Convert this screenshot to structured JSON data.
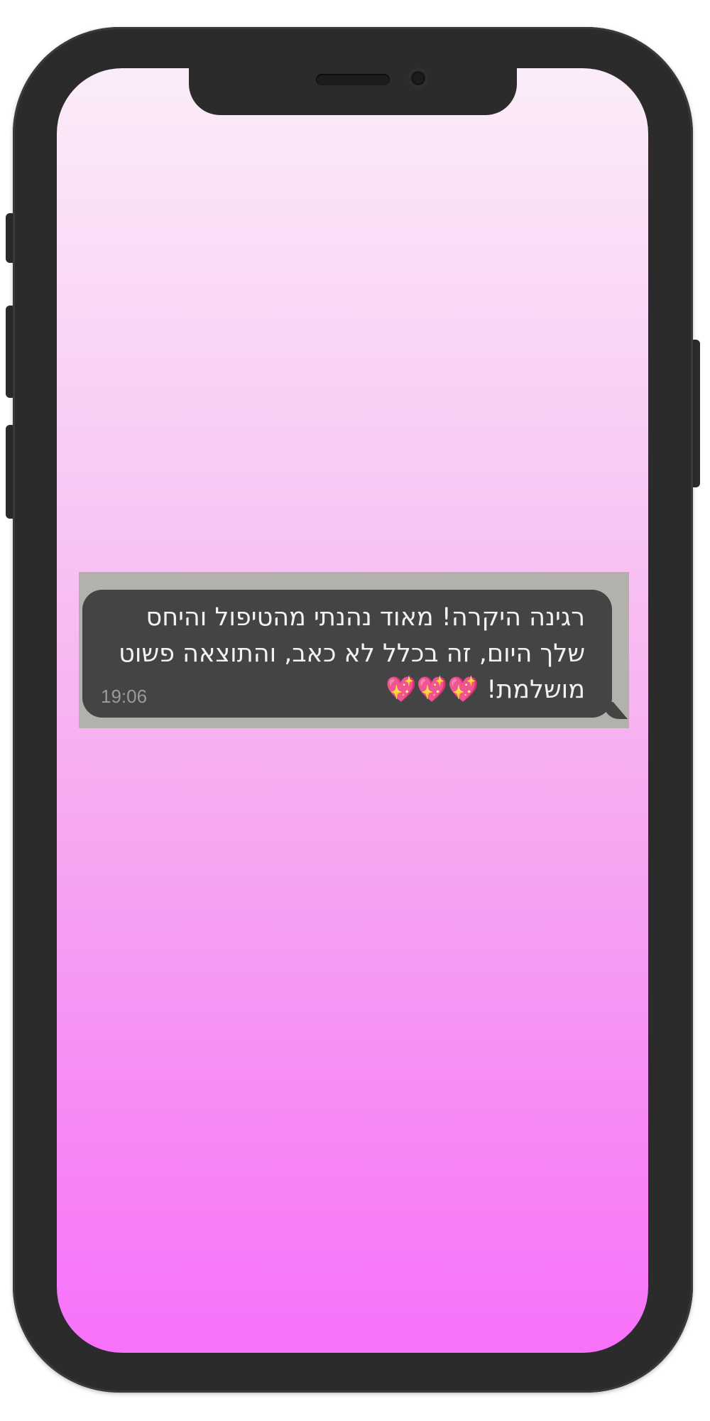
{
  "message": {
    "text": "רגינה היקרה! מאוד נהנתי מהטיפול והיחס שלך היום, זה בכלל לא כאב, והתוצאה פשוט מושלמת! 💖💖💖",
    "time": "19:06"
  },
  "colors": {
    "phone_frame": "#2b2b2b",
    "screen_top": "#fbecf9",
    "screen_bottom": "#f771f9",
    "chat_background": "#b3b1ab",
    "bubble": "#444444",
    "bubble_text": "#f2f2f2",
    "time_text": "#9a9a9a"
  }
}
